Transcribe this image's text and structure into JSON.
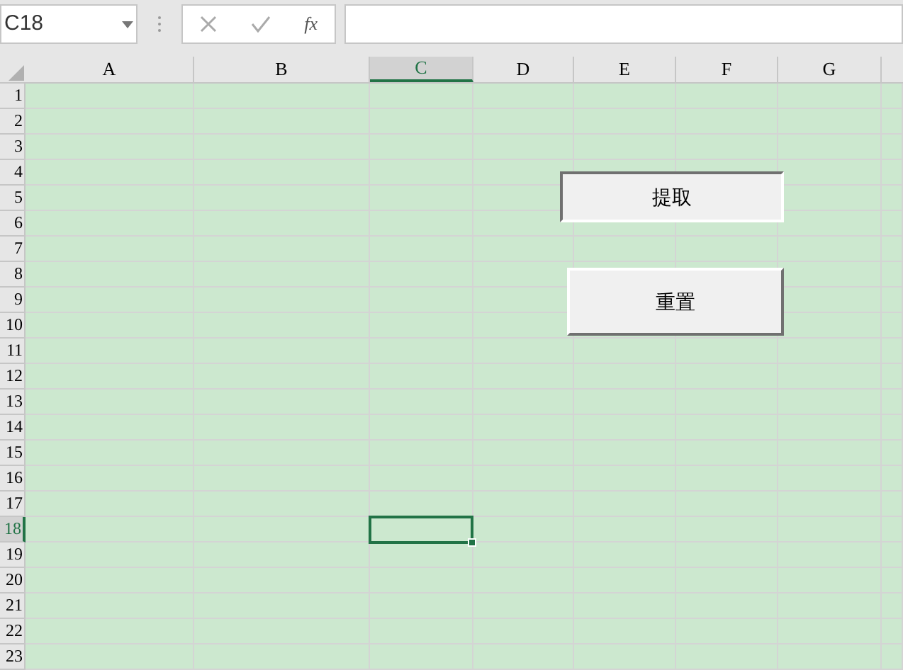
{
  "name_box": {
    "value": "C18"
  },
  "formula_bar": {
    "function_label": "fx"
  },
  "columns": [
    {
      "label": "A",
      "selected": false
    },
    {
      "label": "B",
      "selected": false
    },
    {
      "label": "C",
      "selected": true
    },
    {
      "label": "D",
      "selected": false
    },
    {
      "label": "E",
      "selected": false
    },
    {
      "label": "F",
      "selected": false
    },
    {
      "label": "G",
      "selected": false
    }
  ],
  "rows": [
    {
      "label": "1",
      "selected": false
    },
    {
      "label": "2",
      "selected": false
    },
    {
      "label": "3",
      "selected": false
    },
    {
      "label": "4",
      "selected": false
    },
    {
      "label": "5",
      "selected": false
    },
    {
      "label": "6",
      "selected": false
    },
    {
      "label": "7",
      "selected": false
    },
    {
      "label": "8",
      "selected": false
    },
    {
      "label": "9",
      "selected": false
    },
    {
      "label": "10",
      "selected": false
    },
    {
      "label": "11",
      "selected": false
    },
    {
      "label": "12",
      "selected": false
    },
    {
      "label": "13",
      "selected": false
    },
    {
      "label": "14",
      "selected": false
    },
    {
      "label": "15",
      "selected": false
    },
    {
      "label": "16",
      "selected": false
    },
    {
      "label": "17",
      "selected": false
    },
    {
      "label": "18",
      "selected": true
    },
    {
      "label": "19",
      "selected": false
    },
    {
      "label": "20",
      "selected": false
    },
    {
      "label": "21",
      "selected": false
    },
    {
      "label": "22",
      "selected": false
    },
    {
      "label": "23",
      "selected": false
    }
  ],
  "buttons": [
    {
      "label": "提取"
    },
    {
      "label": "重置"
    }
  ]
}
